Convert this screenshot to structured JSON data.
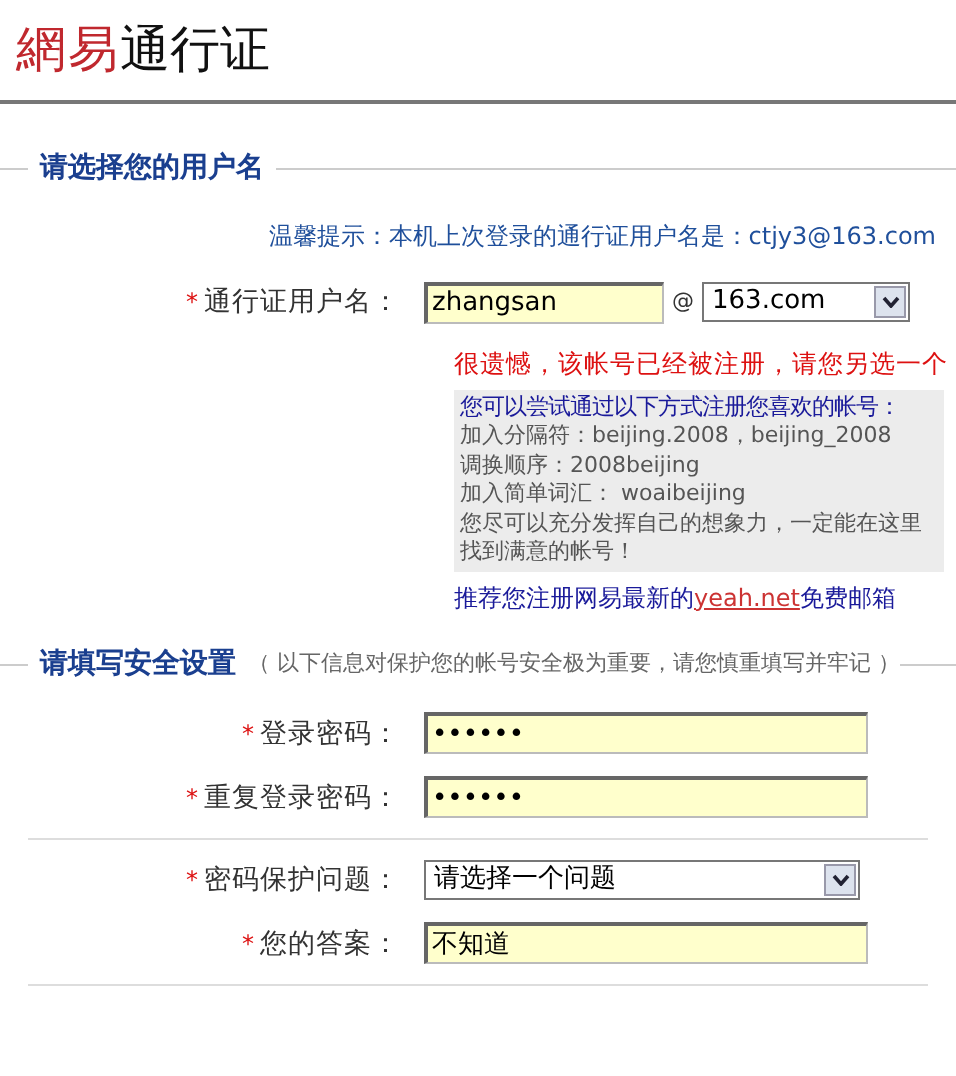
{
  "logo": {
    "brand": "網易",
    "product": "通行证"
  },
  "username_section": {
    "title": "请选择您的用户名",
    "hint": "温馨提示：本机上次登录的通行证用户名是：ctjy3@163.com",
    "field": {
      "marker": "*",
      "label": "通行证用户名：",
      "value": "zhangsan"
    },
    "at": "@",
    "domain": {
      "value": "163.com"
    },
    "error": "很遗憾，该帐号已经被注册，请您另选一个",
    "suggestions": {
      "heading": "您可以尝试通过以下方式注册您喜欢的帐号：",
      "lines": [
        "加入分隔符：beijing.2008，beijing_2008",
        "调换顺序：2008beijing",
        "加入简单词汇： woaibeijing",
        "您尽可以充分发挥自己的想象力，一定能在这里找到满意的帐号！"
      ]
    },
    "recommend": {
      "before": "推荐您注册网易最新的",
      "link": "yeah.net",
      "after": "免费邮箱"
    }
  },
  "security_section": {
    "title": "请填写安全设置",
    "note": "（ 以下信息对保护您的帐号安全极为重要，请您慎重填写并牢记 ）",
    "groups": [
      {
        "fields": [
          {
            "kind": "text",
            "marker": "*",
            "label": "登录密码：",
            "value": "••••••"
          },
          {
            "kind": "text",
            "marker": "*",
            "label": "重复登录密码：",
            "value": "••••••"
          }
        ]
      },
      {
        "fields": [
          {
            "kind": "select",
            "marker": "*",
            "label": "密码保护问题：",
            "value": "请选择一个问题"
          },
          {
            "kind": "text",
            "marker": "*",
            "label": "您的答案：",
            "value": "不知道"
          }
        ]
      }
    ]
  }
}
